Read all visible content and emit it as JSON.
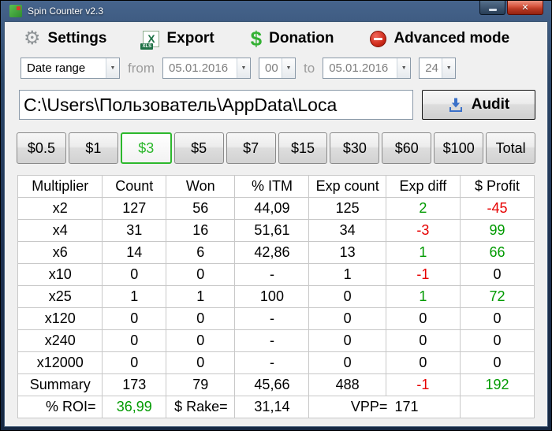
{
  "window": {
    "title": "Spin Counter v2.3",
    "close_glyph": "✕"
  },
  "toolbar": {
    "settings_label": "Settings",
    "export_label": "Export",
    "excel_icon_text": "X",
    "excel_icon_badge": "XLS",
    "donation_label": "Donation",
    "donation_icon": "$",
    "advanced_label": "Advanced mode"
  },
  "filters": {
    "range_selector": "Date range",
    "from_label": "from",
    "from_date": "05.01.2016",
    "from_hour": "00",
    "to_label": "to",
    "to_date": "05.01.2016",
    "to_hour": "24"
  },
  "path_bar": {
    "path_value": "C:\\Users\\Пользователь\\AppData\\Loca",
    "audit_label": "Audit"
  },
  "stake_tabs": [
    {
      "label": "$0.5",
      "selected": false
    },
    {
      "label": "$1",
      "selected": false
    },
    {
      "label": "$3",
      "selected": true
    },
    {
      "label": "$5",
      "selected": false
    },
    {
      "label": "$7",
      "selected": false
    },
    {
      "label": "$15",
      "selected": false
    },
    {
      "label": "$30",
      "selected": false
    },
    {
      "label": "$60",
      "selected": false
    },
    {
      "label": "$100",
      "selected": false
    },
    {
      "label": "Total",
      "selected": false
    }
  ],
  "results_table": {
    "headers": [
      "Multiplier",
      "Count",
      "Won",
      "% ITM",
      "Exp count",
      "Exp diff",
      "$ Profit"
    ],
    "rows": [
      {
        "cells": [
          "x2",
          "127",
          "56",
          "44,09",
          "125",
          "2",
          "-45"
        ],
        "colors": [
          "",
          "",
          "",
          "",
          "",
          "green",
          "red"
        ]
      },
      {
        "cells": [
          "x4",
          "31",
          "16",
          "51,61",
          "34",
          "-3",
          "99"
        ],
        "colors": [
          "",
          "",
          "",
          "",
          "",
          "red",
          "green"
        ]
      },
      {
        "cells": [
          "x6",
          "14",
          "6",
          "42,86",
          "13",
          "1",
          "66"
        ],
        "colors": [
          "",
          "",
          "",
          "",
          "",
          "green",
          "green"
        ]
      },
      {
        "cells": [
          "x10",
          "0",
          "0",
          "-",
          "1",
          "-1",
          "0"
        ],
        "colors": [
          "",
          "",
          "",
          "",
          "",
          "red",
          ""
        ]
      },
      {
        "cells": [
          "x25",
          "1",
          "1",
          "100",
          "0",
          "1",
          "72"
        ],
        "colors": [
          "",
          "",
          "",
          "",
          "",
          "green",
          "green"
        ]
      },
      {
        "cells": [
          "x120",
          "0",
          "0",
          "-",
          "0",
          "0",
          "0"
        ],
        "colors": [
          "",
          "",
          "",
          "",
          "",
          "",
          ""
        ]
      },
      {
        "cells": [
          "x240",
          "0",
          "0",
          "-",
          "0",
          "0",
          "0"
        ],
        "colors": [
          "",
          "",
          "",
          "",
          "",
          "",
          ""
        ]
      },
      {
        "cells": [
          "x12000",
          "0",
          "0",
          "-",
          "0",
          "0",
          "0"
        ],
        "colors": [
          "",
          "",
          "",
          "",
          "",
          "",
          ""
        ]
      },
      {
        "cells": [
          "Summary",
          "173",
          "79",
          "45,66",
          "488",
          "-1",
          "192"
        ],
        "colors": [
          "",
          "",
          "",
          "",
          "",
          "red",
          "green"
        ]
      }
    ],
    "footer": {
      "roi_label": "% ROI=",
      "roi_value": "36,99",
      "rake_label": "$ Rake=",
      "rake_value": "31,14",
      "vpp_label": "VPP=",
      "vpp_value": "171"
    }
  },
  "colors": {
    "positive": "#009a00",
    "negative": "#e60000",
    "selected_tab": "#2db82d"
  }
}
